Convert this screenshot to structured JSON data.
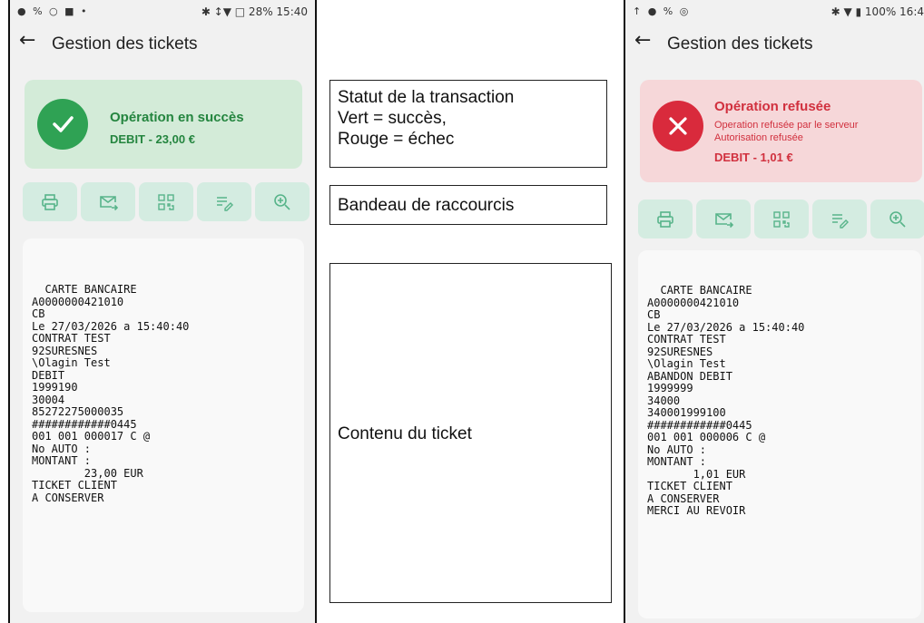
{
  "left_screen": {
    "status_bar": {
      "left_icons": "● % ○ ■ •",
      "right": "✱ ↕▼ □ 28% 15:40"
    },
    "app_bar": {
      "back": "←",
      "title": "Gestion des tickets"
    },
    "status": {
      "kind": "success",
      "headline": "Opération en succès",
      "amount": "DEBIT - 23,00 €"
    },
    "shortcuts": [
      "printer-icon",
      "email-icon",
      "qr-code-icon",
      "edit-note-icon",
      "zoom-in-icon"
    ],
    "ticket_lines": [
      "  CARTE BANCAIRE",
      "A0000000421010",
      "CB",
      "Le 27/03/2026 a 15:40:40",
      "CONTRAT TEST",
      "92SURESNES",
      "\\Olagin Test",
      "DEBIT",
      "1999190",
      "30004",
      "85272275000035",
      "############0445",
      "001 001 000017 C @",
      "No AUTO :",
      "MONTANT :",
      "        23,00 EUR",
      "TICKET CLIENT",
      "A CONSERVER"
    ]
  },
  "annotations": {
    "status_note": [
      "Statut de la transaction",
      "Vert = succès,",
      "Rouge = échec"
    ],
    "shortcuts_note": "Bandeau de raccourcis",
    "ticket_note": "Contenu du ticket"
  },
  "right_screen": {
    "status_bar": {
      "left_icons": "↑ ● % ◎",
      "right": "✱ ▼ ▮ 100% 16:4"
    },
    "app_bar": {
      "back": "←",
      "title": "Gestion des tickets"
    },
    "status": {
      "kind": "failure",
      "headline": "Opération refusée",
      "detail_1": "Operation refusée par le serveur",
      "detail_2": "Autorisation refusée",
      "amount": "DEBIT - 1,01 €"
    },
    "shortcuts": [
      "printer-icon",
      "email-icon",
      "qr-code-icon",
      "edit-note-icon",
      "zoom-in-icon"
    ],
    "ticket_lines": [
      "  CARTE BANCAIRE",
      "A0000000421010",
      "CB",
      "Le 27/03/2026 a 15:40:40",
      "CONTRAT TEST",
      "92SURESNES",
      "\\Olagin Test",
      "ABANDON DEBIT",
      "1999999",
      "34000",
      "340001999100",
      "############0445",
      "001 001 000006 C @",
      "No AUTO :",
      "MONTANT :",
      "       1,01 EUR",
      "TICKET CLIENT",
      "A CONSERVER",
      "MERCI AU REVOIR"
    ]
  },
  "colors": {
    "success_bg": "#d3ebd8",
    "success_accent": "#2fa254",
    "failure_bg": "#f6d7d9",
    "failure_accent": "#d92a3c",
    "shortcut_bg": "#d4ece1",
    "shortcut_icon": "#58b48a"
  }
}
